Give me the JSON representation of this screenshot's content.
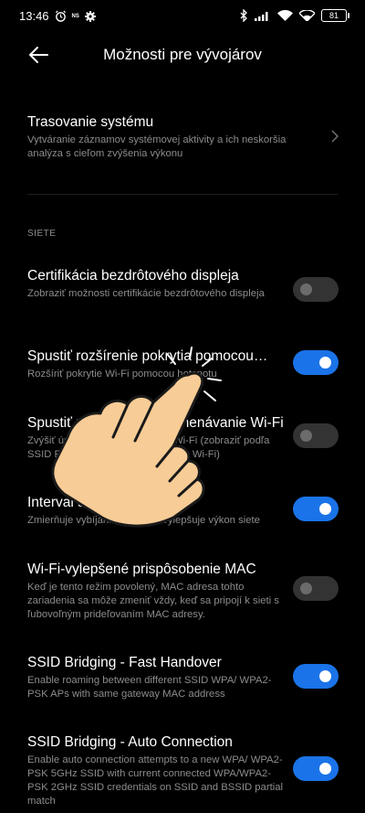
{
  "status": {
    "time": "13:46",
    "ns": "NS",
    "battery": "81"
  },
  "header": {
    "title": "Možnosti pre vývojárov"
  },
  "tracing": {
    "title": "Trasovanie systému",
    "subtitle": "Vytváranie záznamov systémovej aktivity a ich neskoršia analýza s cieľom zvýšenia výkonu"
  },
  "section": {
    "label": "SIETE"
  },
  "items": [
    {
      "title": "Certifikácia bezdrôtového displeja",
      "subtitle": "Zobraziť možnosti certifikácie bezdrôtového displeja",
      "enabled": false
    },
    {
      "title": "Spustiť rozšírenie pokrytia pomocou…",
      "subtitle": "Rozšíriť pokrytie Wi-Fi pomocou hotspotu",
      "enabled": true
    },
    {
      "title": "Spustiť podrobné zaznamenávanie Wi-Fi",
      "subtitle": "Zvýšiť úroveň zaznamenávania Wi-Fi (zobraziť podľa SSID RSSI v nástroji na výber siete Wi-Fi)",
      "enabled": false
    },
    {
      "title": "Interval skenovania Wi-Fi",
      "subtitle": "Zmierňuje vybíjanie batérie a vylepšuje výkon siete",
      "enabled": true
    },
    {
      "title": "Wi-Fi-vylepšené prispôsobenie MAC",
      "subtitle": "Keď je tento režim povolený, MAC adresa tohto zariadenia sa môže zmeniť vždy, keď sa pripojí k sieti s ľubovoľným prideľovaním MAC adresy.",
      "enabled": false
    },
    {
      "title": "SSID Bridging - Fast Handover",
      "subtitle": "Enable roaming between different SSID WPA/ WPA2-PSK APs with same gateway MAC address",
      "enabled": true
    },
    {
      "title": "SSID Bridging - Auto Connection",
      "subtitle": "Enable auto connection attempts to a new WPA/ WPA2-PSK 5GHz SSID with current connected WPA/WPA2-PSK 2GHz SSID credentials on SSID and BSSID partial match",
      "enabled": true
    }
  ]
}
